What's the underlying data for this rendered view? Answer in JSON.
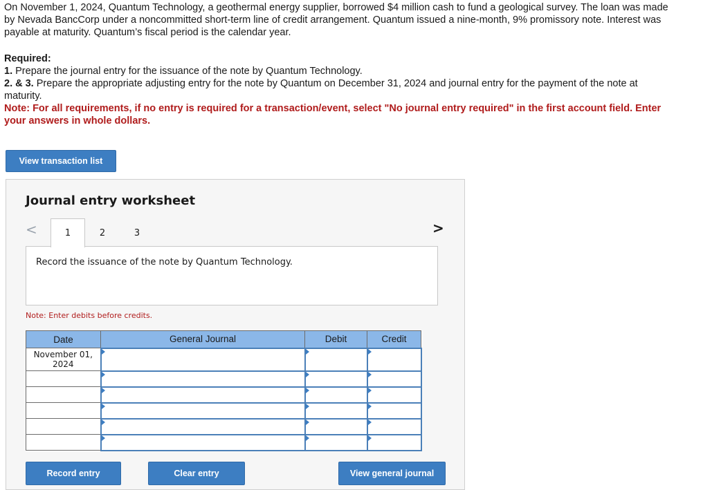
{
  "problem": {
    "text": "On November 1, 2024, Quantum Technology, a geothermal energy supplier, borrowed $4 million cash to fund a geological survey. The loan was made by Nevada BancCorp under a noncommitted short-term line of credit arrangement. Quantum issued a nine-month, 9% promissory note. Interest was payable at maturity. Quantum’s fiscal period is the calendar year."
  },
  "required": {
    "heading": "Required:",
    "items": [
      {
        "num": "1.",
        "text": "Prepare the journal entry for the issuance of the note by Quantum Technology."
      },
      {
        "num": "2. & 3.",
        "text": "Prepare the appropriate adjusting entry for the note by Quantum on December 31, 2024 and journal entry for the payment of the note at maturity."
      }
    ],
    "note": "Note: For all requirements, if no entry is required for a transaction/event, select \"No journal entry required\" in the first account field. Enter your answers in whole dollars."
  },
  "buttons": {
    "view_transaction_list": "View transaction list",
    "record_entry": "Record entry",
    "clear_entry": "Clear entry",
    "view_general_journal": "View general journal"
  },
  "worksheet": {
    "title": "Journal entry worksheet",
    "nav_prev": "<",
    "nav_next": ">",
    "tabs": [
      "1",
      "2",
      "3"
    ],
    "active_tab": "1",
    "instruction": "Record the issuance of the note by Quantum Technology.",
    "note": "Note: Enter debits before credits."
  },
  "journal": {
    "headers": [
      "Date",
      "General Journal",
      "Debit",
      "Credit"
    ],
    "rows": [
      {
        "date": "November 01, 2024",
        "account": "",
        "debit": "",
        "credit": ""
      },
      {
        "date": "",
        "account": "",
        "debit": "",
        "credit": ""
      },
      {
        "date": "",
        "account": "",
        "debit": "",
        "credit": ""
      },
      {
        "date": "",
        "account": "",
        "debit": "",
        "credit": ""
      },
      {
        "date": "",
        "account": "",
        "debit": "",
        "credit": ""
      },
      {
        "date": "",
        "account": "",
        "debit": "",
        "credit": ""
      }
    ]
  },
  "colors": {
    "button": "#3d7ec2",
    "table_header": "#8bb7e8",
    "note_red": "#b01c1c"
  }
}
